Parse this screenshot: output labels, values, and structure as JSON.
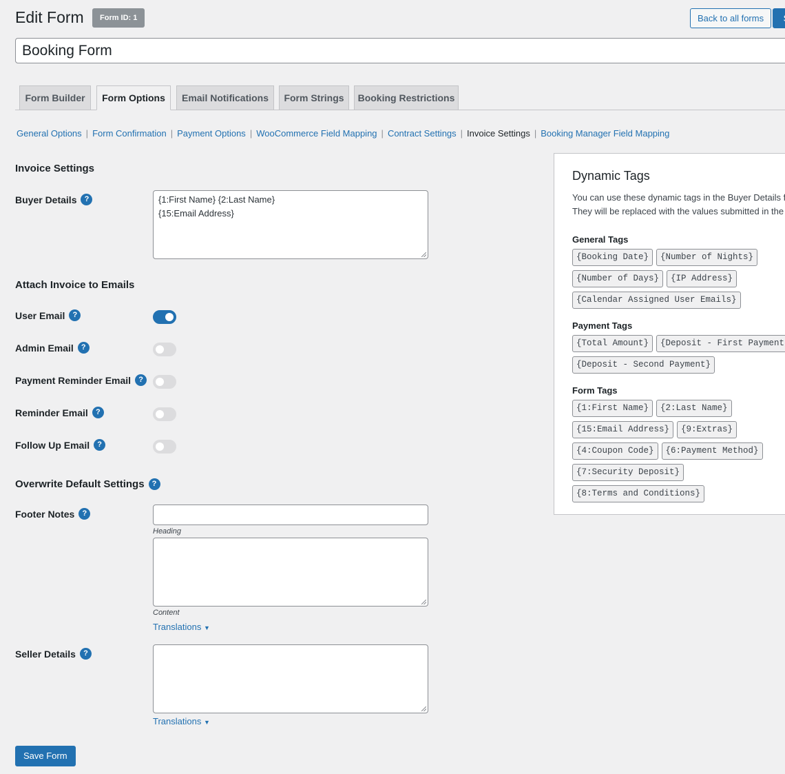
{
  "header": {
    "title": "Edit Form",
    "form_id_badge": "Form ID: 1",
    "back_label": "Back to all forms",
    "save_label": "S"
  },
  "form_title": "Booking Form",
  "tabs": [
    {
      "label": "Form Builder",
      "active": false
    },
    {
      "label": "Form Options",
      "active": true
    },
    {
      "label": "Email Notifications",
      "active": false
    },
    {
      "label": "Form Strings",
      "active": false
    },
    {
      "label": "Booking Restrictions",
      "active": false
    }
  ],
  "subnav": [
    {
      "label": "General Options",
      "current": false
    },
    {
      "label": "Form Confirmation",
      "current": false
    },
    {
      "label": "Payment Options",
      "current": false
    },
    {
      "label": "WooCommerce Field Mapping",
      "current": false
    },
    {
      "label": "Contract Settings",
      "current": false
    },
    {
      "label": "Invoice Settings",
      "current": true
    },
    {
      "label": "Booking Manager Field Mapping",
      "current": false
    }
  ],
  "invoice": {
    "section_title": "Invoice Settings",
    "buyer_label": "Buyer Details",
    "buyer_value": "{1:First Name} {2:Last Name}\n{15:Email Address}"
  },
  "attach": {
    "section_title": "Attach Invoice to Emails",
    "toggles": [
      {
        "label": "User Email",
        "on": true
      },
      {
        "label": "Admin Email",
        "on": false
      },
      {
        "label": "Payment Reminder Email",
        "on": false
      },
      {
        "label": "Reminder Email",
        "on": false
      },
      {
        "label": "Follow Up Email",
        "on": false
      }
    ]
  },
  "overwrite": {
    "section_title": "Overwrite Default Settings",
    "footer_label": "Footer Notes",
    "heading_hint": "Heading",
    "content_hint": "Content",
    "translations_link": "Translations",
    "seller_label": "Seller Details",
    "seller_translations_link": "Translations"
  },
  "save_form_label": "Save Form",
  "dynamic_tags": {
    "title": "Dynamic Tags",
    "desc_line1": "You can use these dynamic tags in the Buyer Details fi",
    "desc_line2": "They will be replaced with the values submitted in the",
    "groups": [
      {
        "title": "General Tags",
        "tags": [
          "{Booking Date}",
          "{Number of Nights}",
          "{Number of Days}",
          "{IP Address}",
          "{Calendar Assigned User Emails}"
        ]
      },
      {
        "title": "Payment Tags",
        "tags": [
          "{Total Amount}",
          "{Deposit - First Payment}",
          "{Deposit - Second Payment}"
        ]
      },
      {
        "title": "Form Tags",
        "tags": [
          "{1:First Name}",
          "{2:Last Name}",
          "{15:Email Address}",
          "{9:Extras}",
          "{4:Coupon Code}",
          "{6:Payment Method}",
          "{7:Security Deposit}",
          "{8:Terms and Conditions}"
        ]
      }
    ]
  },
  "colors": {
    "accent": "#2271b1",
    "badge": "#8c9297",
    "background": "#f0f0f1"
  }
}
